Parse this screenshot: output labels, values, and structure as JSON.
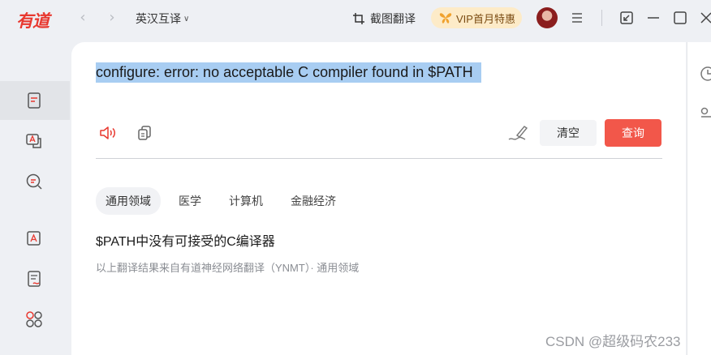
{
  "app": {
    "logo_text": "有道",
    "lang_pair": "英汉互译",
    "screenshot_label": "截图翻译",
    "vip_label": "VIP首月特惠"
  },
  "input": {
    "source_text": "configure: error: no acceptable C compiler found in $PATH",
    "clear_label": "清空",
    "query_label": "查询"
  },
  "domains": {
    "tabs": [
      {
        "label": "通用领域",
        "active": true
      },
      {
        "label": "医学",
        "active": false
      },
      {
        "label": "计算机",
        "active": false
      },
      {
        "label": "金融经济",
        "active": false
      }
    ]
  },
  "result": {
    "translation": "$PATH中没有可接受的C编译器",
    "source_note": "以上翻译结果来自有道神经网络翻译（YNMT）· 通用领域"
  },
  "watermark": "CSDN @超级码农233",
  "colors": {
    "brand_red": "#e8382f",
    "query_button": "#f2574a",
    "selection": "#a8cdf2"
  }
}
